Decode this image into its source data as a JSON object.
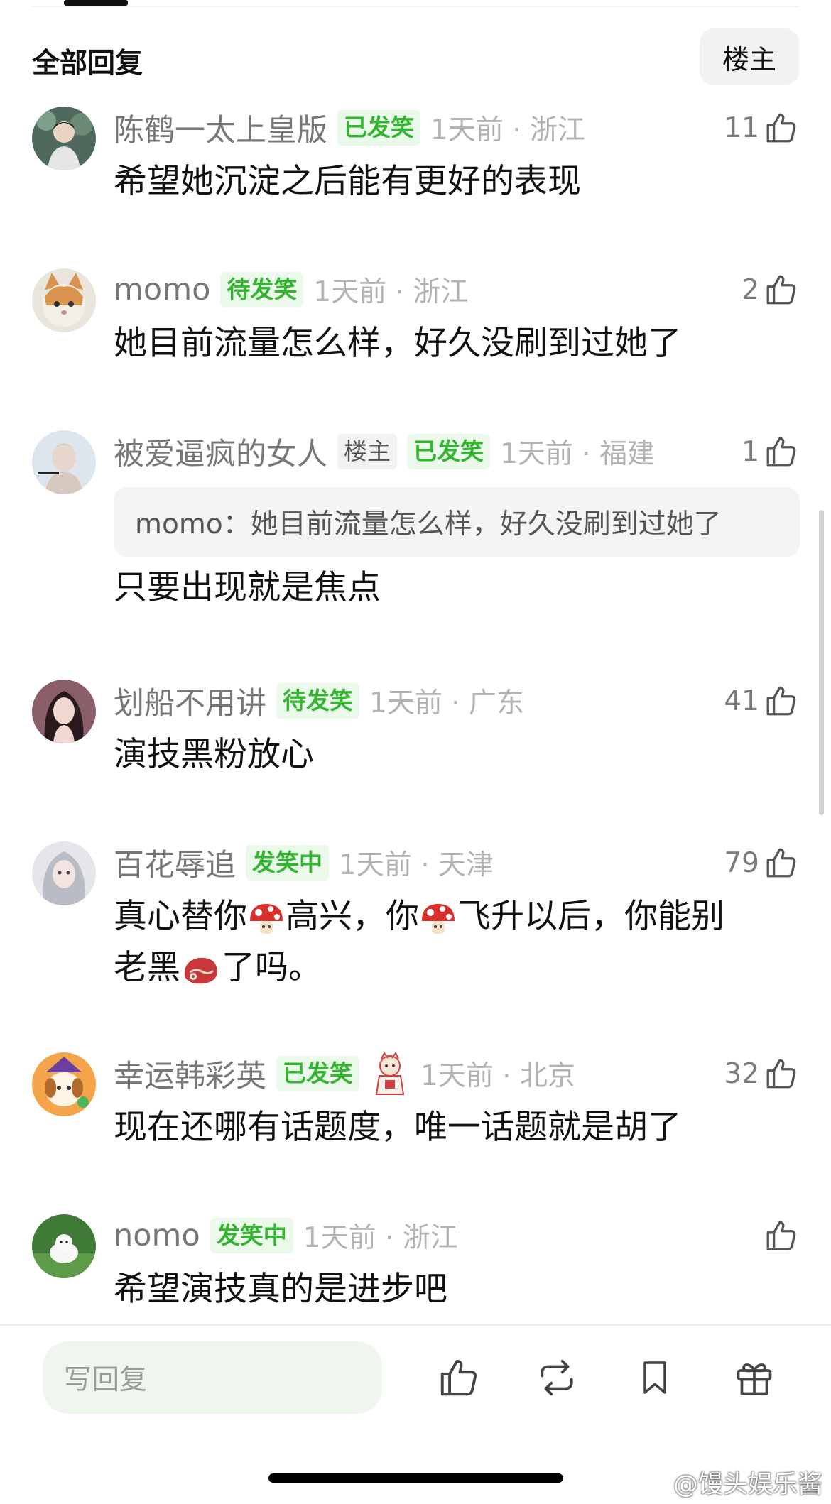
{
  "section": {
    "title": "全部回复",
    "filter_button": "楼主"
  },
  "comments": [
    {
      "username": "陈鹤一太上皇版",
      "badges": [
        "已发笑"
      ],
      "time_location": "1天前 · 浙江",
      "likes": "11",
      "text": "希望她沉淀之后能有更好的表现"
    },
    {
      "username": "momo",
      "badges": [
        "待发笑"
      ],
      "time_location": "1天前 · 浙江",
      "likes": "2",
      "text": "她目前流量怎么样，好久没刷到过她了"
    },
    {
      "username": "被爱逼疯的女人",
      "badges": [
        "楼主",
        "已发笑"
      ],
      "time_location": "1天前 · 福建",
      "likes": "1",
      "quote": "momo：她目前流量怎么样，好久没刷到过她了",
      "text": "只要出现就是焦点"
    },
    {
      "username": "划船不用讲",
      "badges": [
        "待发笑"
      ],
      "time_location": "1天前 · 广东",
      "likes": "41",
      "text": "演技黑粉放心"
    },
    {
      "username": "百花辱追",
      "badges": [
        "发笑中"
      ],
      "time_location": "1天前 · 天津",
      "likes": "79",
      "text_parts": [
        "真心替你",
        "高兴，你",
        "飞升以后，你能别",
        "老黑",
        "了吗。"
      ],
      "emojis": [
        "mushroom-icon",
        "mushroom-icon",
        "meat-icon"
      ]
    },
    {
      "username": "幸运韩彩英",
      "badges": [
        "已发笑"
      ],
      "time_location": "1天前 · 北京",
      "likes": "32",
      "text": "现在还哪有话题度，唯一话题就是胡了"
    },
    {
      "username": "nomo",
      "badges": [
        "发笑中"
      ],
      "time_location": "1天前 · 浙江",
      "likes": "",
      "text": "希望演技真的是进步吧"
    }
  ],
  "bottom_bar": {
    "reply_placeholder": "写回复",
    "actions": [
      "like-icon",
      "repost-icon",
      "bookmark-icon",
      "gift-icon"
    ]
  },
  "watermark": "@馒头娱乐酱",
  "colors": {
    "badge_green": "#34b52f",
    "badge_bg": "#eaf9ea",
    "meta_gray": "#b3b3b3"
  }
}
